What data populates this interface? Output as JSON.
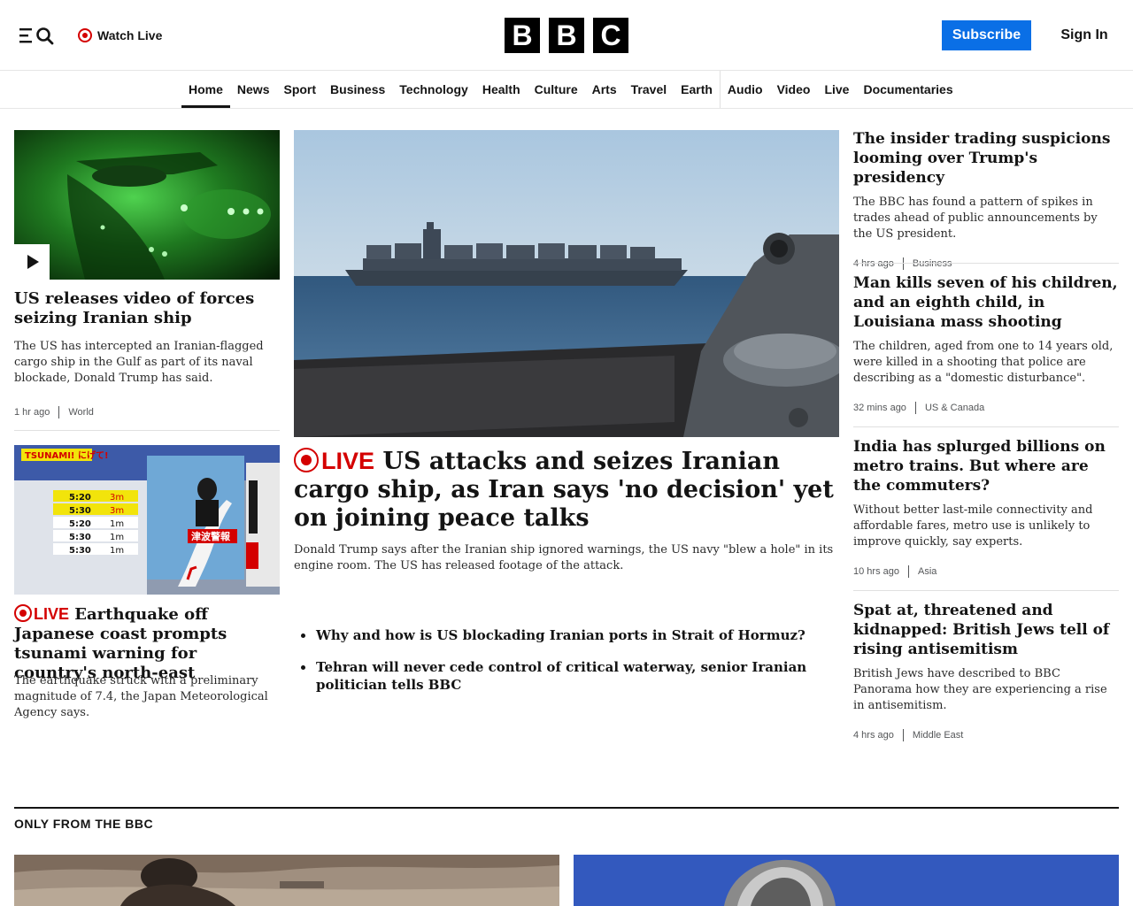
{
  "header": {
    "watch_live": "Watch Live",
    "logo_letters": [
      "B",
      "B",
      "C"
    ],
    "subscribe": "Subscribe",
    "sign_in": "Sign In"
  },
  "nav": [
    "Home",
    "News",
    "Sport",
    "Business",
    "Technology",
    "Health",
    "Culture",
    "Arts",
    "Travel",
    "Earth",
    "Audio",
    "Video",
    "Live",
    "Documentaries"
  ],
  "left": {
    "story1": {
      "headline": "US releases video of forces seizing Iranian ship",
      "summary": "The US has intercepted an Iranian-flagged cargo ship in the Gulf as part of its naval blockade, Donald Trump has said.",
      "time": "1 hr ago",
      "section": "World"
    },
    "story2": {
      "live": "LIVE",
      "headline": "Earthquake off Japanese coast prompts tsunami warning for country's north-east",
      "summary": "The earthquake struck with a preliminary magnitude of 7.4, the Japan Meteorological Agency says."
    }
  },
  "main": {
    "live": "LIVE",
    "headline": "US attacks and seizes Iranian cargo ship, as Iran says 'no decision' yet on joining peace talks",
    "summary": "Donald Trump says after the Iranian ship ignored warnings, the US navy \"blew a hole\" in its engine room. The US has released footage of the attack.",
    "related": [
      "Why and how is US blockading Iranian ports in Strait of Hormuz?",
      "Tehran will never cede control of critical waterway, senior Iranian politician tells BBC"
    ]
  },
  "right": [
    {
      "headline": "The insider trading suspicions looming over Trump's presidency",
      "summary": "The BBC has found a pattern of spikes in trades ahead of public announcements by the US president.",
      "time": "4 hrs ago",
      "section": "Business"
    },
    {
      "headline": "Man kills seven of his children, and an eighth child, in Louisiana mass shooting",
      "summary": "The children, aged from one to 14 years old, were killed in a shooting that police are describing as a \"domestic disturbance\".",
      "time": "32 mins ago",
      "section": "US & Canada"
    },
    {
      "headline": "India has splurged billions on metro trains. But where are the commuters?",
      "summary": "Without better last-mile connectivity and affordable fares, metro use is unlikely to improve quickly, say experts.",
      "time": "10 hrs ago",
      "section": "Asia"
    },
    {
      "headline": "Spat at, threatened and kidnapped: British Jews tell of rising antisemitism",
      "summary": "British Jews have described to BBC Panorama how they are experiencing a rise in antisemitism.",
      "time": "4 hrs ago",
      "section": "Middle East"
    }
  ],
  "only_from_bbc": {
    "title": "ONLY FROM THE BBC"
  },
  "tv_graphic": {
    "tsunami_banner": "TSUNAMI! にげて!",
    "rows": [
      {
        "time": "5:20",
        "height": "3m"
      },
      {
        "time": "5:30",
        "height": "3m"
      },
      {
        "time": "5:20",
        "height": "1m"
      },
      {
        "time": "5:30",
        "height": "1m"
      },
      {
        "time": "5:30",
        "height": "1m"
      }
    ],
    "warning_label": "津波警報"
  },
  "colors": {
    "live_red": "#d40000",
    "subscribe_blue": "#0a6fe6",
    "text": "#141414",
    "meta": "#545658"
  }
}
